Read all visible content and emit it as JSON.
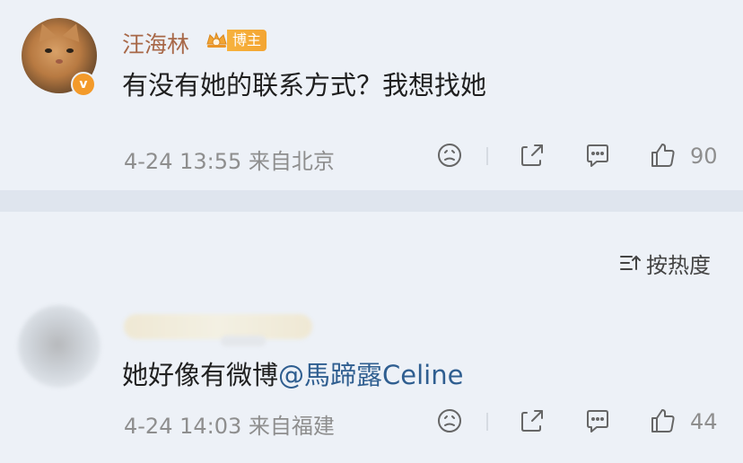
{
  "comments": [
    {
      "username": "汪海林",
      "badge": "博主",
      "text": "有没有她的联系方式？我想找她",
      "meta": "4-24 13:55 来自北京",
      "likes": "90"
    },
    {
      "username": "",
      "text": "她好像有微博",
      "mention": "@馬蹄露Celine",
      "meta": "4-24 14:03 来自福建",
      "likes": "44"
    }
  ],
  "sort_label": "按热度",
  "colors": {
    "username": "#a86848",
    "mention": "#2f5e90",
    "badge": "#f3a532",
    "meta": "#8e8e8e"
  },
  "icons": {
    "verified": "verified-badge-icon",
    "emoji": "emoji-reaction-icon",
    "share": "share-icon",
    "comment": "comment-icon",
    "like": "thumbs-up-icon",
    "sort": "sort-icon"
  }
}
